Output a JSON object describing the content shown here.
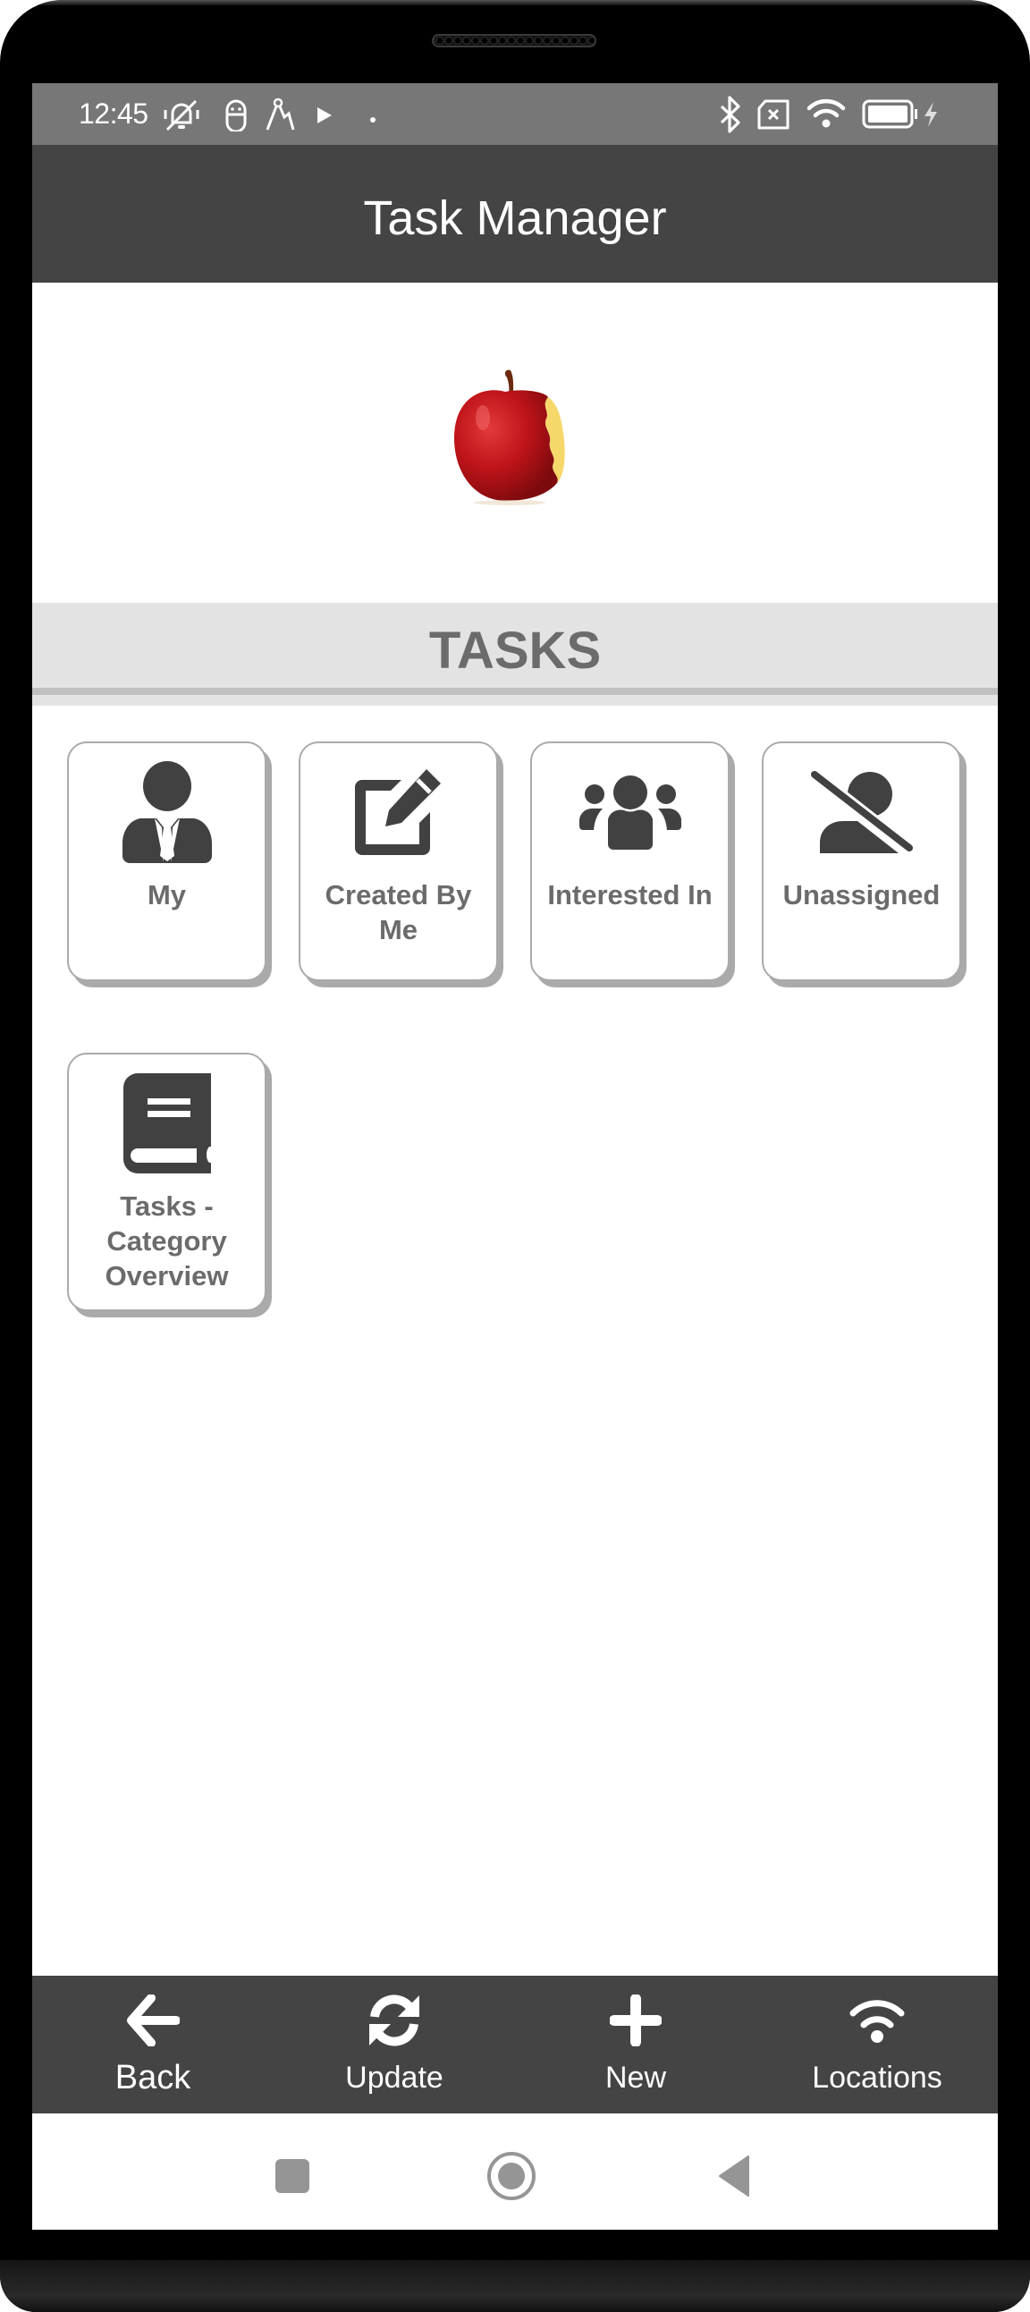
{
  "status_bar": {
    "time": "12:45",
    "left_icons": [
      "vibrate-off-icon",
      "android-debug-icon",
      "compass-tool-icon",
      "play-store-icon",
      "dot-icon"
    ],
    "right_icons": [
      "bluetooth-icon",
      "no-sim-icon",
      "wifi-icon",
      "battery-icon",
      "charging-icon"
    ]
  },
  "header": {
    "title": "Task Manager"
  },
  "hero": {
    "image": "bitten-apple"
  },
  "section": {
    "title": "TASKS"
  },
  "tiles": [
    {
      "label": "My",
      "icon": "user-tie-icon"
    },
    {
      "label": "Created By Me",
      "icon": "edit-icon"
    },
    {
      "label": "Interested In",
      "icon": "users-icon"
    },
    {
      "label": "Unassigned",
      "icon": "user-slash-icon"
    },
    {
      "label": "Tasks - Category Overview",
      "icon": "book-icon"
    }
  ],
  "bottom_bar": [
    {
      "label": "Back",
      "icon": "arrow-left-icon"
    },
    {
      "label": "Update",
      "icon": "sync-icon"
    },
    {
      "label": "New",
      "icon": "plus-icon"
    },
    {
      "label": "Locations",
      "icon": "wifi-icon"
    }
  ],
  "nav_bar": [
    "recents-button",
    "home-button",
    "back-button"
  ],
  "colors": {
    "header_bg": "#444444",
    "status_bg": "#777777",
    "section_bg": "#e3e3e3",
    "section_text": "#6b6b6b",
    "tile_border": "#aaaaaa",
    "icon_dark": "#414141",
    "nav_gray": "#959595"
  }
}
